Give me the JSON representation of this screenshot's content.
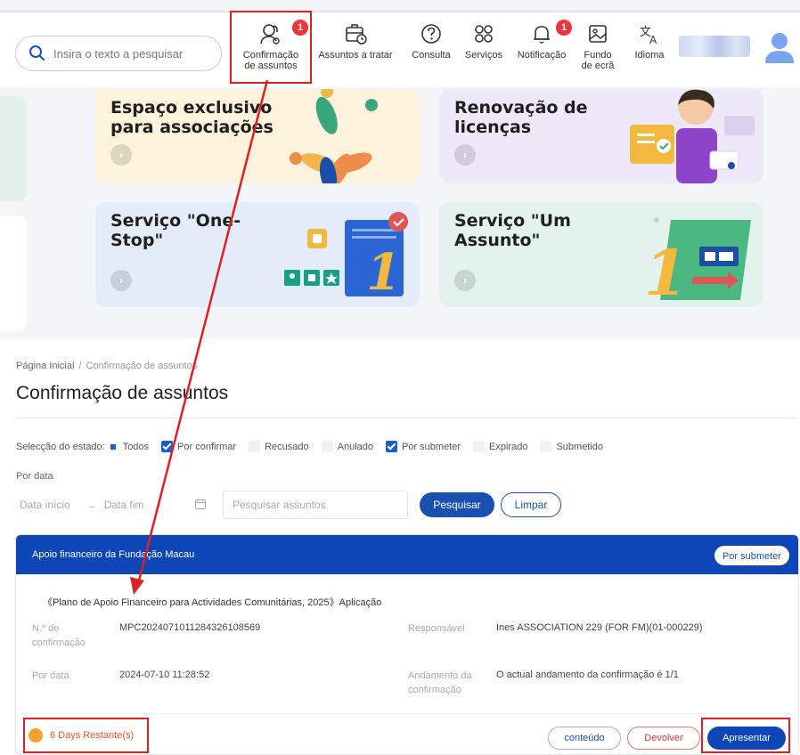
{
  "header": {
    "search_placeholder": "Insira o texto a pesquisar",
    "nav": [
      {
        "label": "Confirmação\nde assuntos",
        "icon": "people-icon",
        "badge": "1"
      },
      {
        "label": "Assuntos a tratar",
        "icon": "briefcase-clock-icon"
      },
      {
        "label": "Consulta",
        "icon": "question-icon"
      },
      {
        "label": "Serviços",
        "icon": "grid-icon"
      },
      {
        "label": "Notificação",
        "icon": "bell-icon",
        "badge": "1"
      },
      {
        "label": "Fundo\nde ecrã",
        "icon": "image-icon"
      },
      {
        "label": "Idioma",
        "icon": "translate-icon"
      }
    ]
  },
  "cards": [
    {
      "title": "Espaço exclusivo\npara associações",
      "color": "#fdf3dc"
    },
    {
      "title": "Renovação de\nlicenças",
      "color": "#eee9f9"
    },
    {
      "title": "Serviço \"One-\nStop\"",
      "color": "#e4ecfa"
    },
    {
      "title": "Serviço \"Um\nAssunto\"",
      "color": "#e3f2ec"
    }
  ],
  "breadcrumb": {
    "home": "Página Inicial",
    "sep": "/",
    "current": "Confirmação de assuntos"
  },
  "page_title": "Confirmação de assuntos",
  "filters": {
    "label": "Selecção do estado:",
    "options": [
      {
        "label": "Todos",
        "state": "square"
      },
      {
        "label": "Por confirmar",
        "state": "checked"
      },
      {
        "label": "Recusado",
        "state": "unchecked"
      },
      {
        "label": "Anulado",
        "state": "unchecked"
      },
      {
        "label": "Por submeter",
        "state": "checked"
      },
      {
        "label": "Expirado",
        "state": "unchecked"
      },
      {
        "label": "Submetido",
        "state": "unchecked"
      }
    ]
  },
  "date_filter": {
    "label": "Por data",
    "start_placeholder": "Data início",
    "arrow": "→",
    "end_placeholder": "Data fim",
    "search_placeholder": "Pesquisar assuntos",
    "search_button": "Pesquisar",
    "clear_button": "Limpar"
  },
  "task": {
    "header_title": "Apoio financeiro da Fundação Macau",
    "status": "Por submeter",
    "subtitle": "《Plano de Apoio Financeiro para Actividades Comunitárias, 2025》Aplicação",
    "fields": {
      "confirmation_no_label": "N.º de confirmação",
      "confirmation_no": "MPC20240710112843261085​69",
      "responsavel_label": "Responsável",
      "responsavel": "Ines ASSOCIATION 229 (FOR FM)(01-000229)",
      "date_label": "Por data",
      "date": "2024-07-10 11:28:52",
      "progress_label": "Andamento da confirmação",
      "progress": "O actual andamento da confirmação é 1/1"
    },
    "remaining": "6 Days Restante(s)",
    "buttons": {
      "content": "conteúdo",
      "return": "Devolver",
      "submit": "Apresentar"
    }
  },
  "colors": {
    "primary": "#0e46b8",
    "annotation": "#e02020",
    "badge": "#e8373e",
    "remaining": "#e4572e"
  }
}
